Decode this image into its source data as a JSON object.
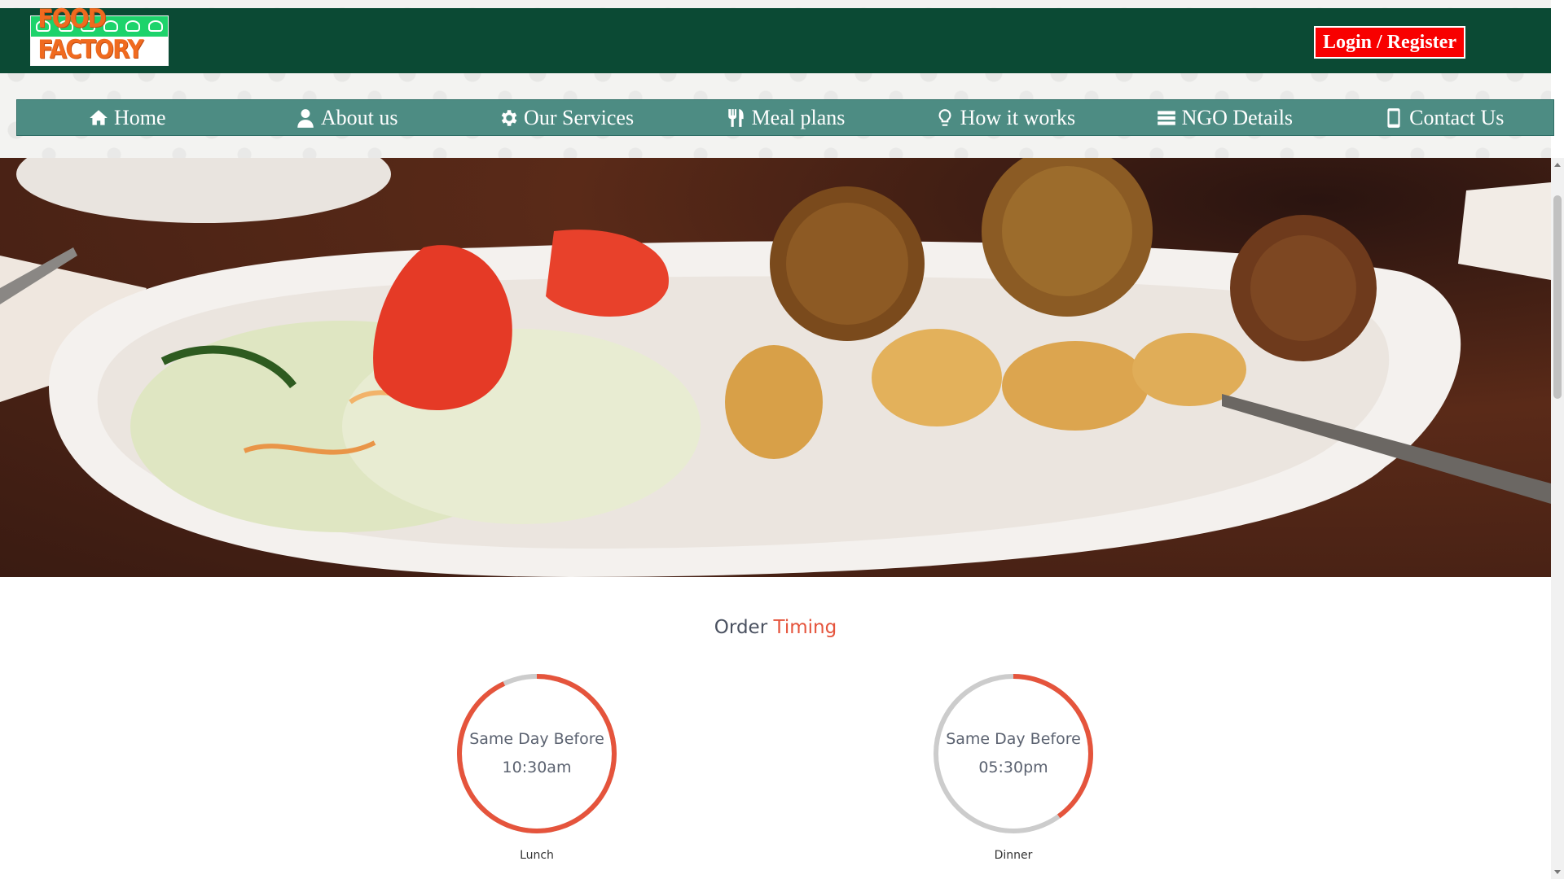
{
  "header": {
    "logo_text": "FOOD FACTORY",
    "login_label": "Login / Register"
  },
  "nav": {
    "items": [
      {
        "label": "Home",
        "icon": "home-icon"
      },
      {
        "label": "About us",
        "icon": "user-icon"
      },
      {
        "label": "Our Services",
        "icon": "gear-icon"
      },
      {
        "label": "Meal plans",
        "icon": "cutlery-icon"
      },
      {
        "label": "How it works",
        "icon": "lightbulb-icon"
      },
      {
        "label": "NGO Details",
        "icon": "list-icon"
      },
      {
        "label": "Contact Us",
        "icon": "mobile-icon"
      }
    ]
  },
  "hero": {
    "icon": "food-plate-image"
  },
  "order_timing": {
    "title_part1": "Order",
    "title_part2": "Timing",
    "timers": [
      {
        "line1": "Same Day Before",
        "line2": "10:30am",
        "label": "Lunch",
        "progress": 0.93
      },
      {
        "line1": "Same Day Before",
        "line2": "05:30pm",
        "label": "Dinner",
        "progress": 0.4
      }
    ]
  },
  "colors": {
    "header_bg": "#0b4a34",
    "nav_bg": "#4d8c83",
    "login_bg": "#f80000",
    "accent": "#e5543c",
    "ring_track": "#cccccc"
  }
}
